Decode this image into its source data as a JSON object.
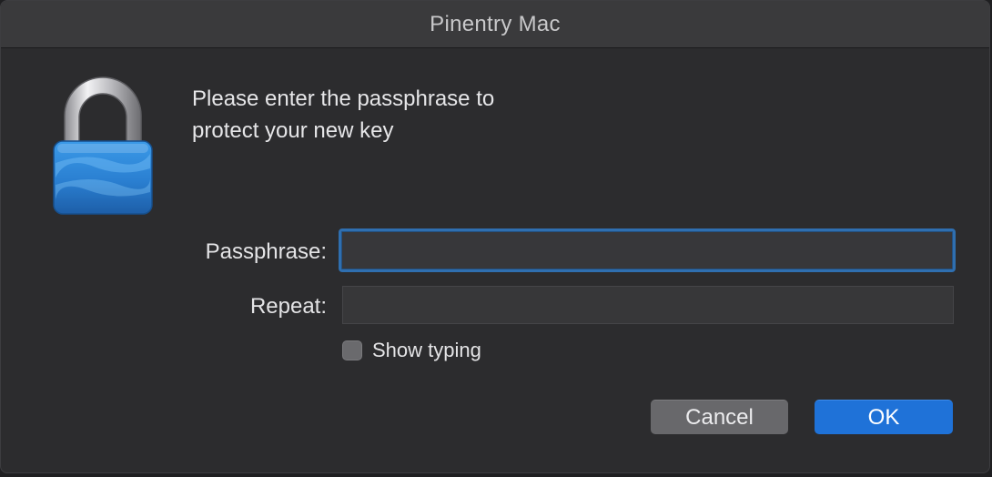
{
  "window": {
    "title": "Pinentry Mac"
  },
  "dialog": {
    "prompt_line1": "Please enter the passphrase to",
    "prompt_line2": "protect your new key",
    "icon": "padlock-icon"
  },
  "form": {
    "passphrase_label": "Passphrase:",
    "passphrase_value": "",
    "repeat_label": "Repeat:",
    "repeat_value": "",
    "show_typing_label": "Show typing",
    "show_typing_checked": false
  },
  "buttons": {
    "cancel_label": "Cancel",
    "ok_label": "OK"
  },
  "colors": {
    "accent": "#1f72d8",
    "focus_ring": "#2f6fb0",
    "lock_blue": "#2e86d8",
    "window_bg": "#2c2c2e"
  }
}
